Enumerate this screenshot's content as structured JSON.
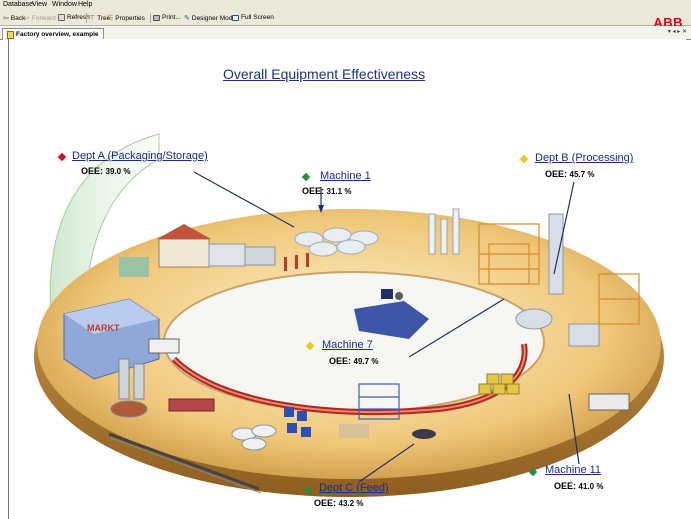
{
  "menu": {
    "items": [
      "Database",
      "View",
      "Window",
      "Help"
    ]
  },
  "toolbar": {
    "back": "Back",
    "forward": "Forward",
    "refresh": "Refresh",
    "tree": "Tree",
    "properties": "Properties",
    "print": "Print...",
    "designer_mode": "Designer Mode",
    "full_screen": "Full Screen"
  },
  "brand": {
    "logo": "ABB",
    "color": "#e2001a"
  },
  "tab": {
    "label": "Factory overview, example",
    "controls": "▾ ◂ ▸ ✕"
  },
  "page": {
    "title": "Overall Equipment Effectiveness"
  },
  "colors": {
    "link": "#1a2c8c",
    "diamond_red": "#c8102e",
    "diamond_green": "#2e8b3e",
    "diamond_yellow": "#f2c419"
  },
  "areas": [
    {
      "name": "Dept A (Packaging/Storage)",
      "oee_label": "OEE:",
      "oee_value": "39.0 %",
      "marker": "red"
    },
    {
      "name": "Machine 1",
      "oee_label": "OEE:",
      "oee_value": "31.1 %",
      "marker": "green"
    },
    {
      "name": "Dept B (Processing)",
      "oee_label": "OEE:",
      "oee_value": "45.7 %",
      "marker": "yellow"
    },
    {
      "name": "Machine 7",
      "oee_label": "OEE:",
      "oee_value": "49.7 %",
      "marker": "yellow"
    },
    {
      "name": "Dept C (Feed)",
      "oee_label": "OEE:",
      "oee_value": "43.2 %",
      "marker": "green"
    },
    {
      "name": "Machine 11",
      "oee_label": "OEE:",
      "oee_value": "41.0 %",
      "marker": "green"
    }
  ],
  "scene": {
    "sign_text": "MARKT"
  }
}
